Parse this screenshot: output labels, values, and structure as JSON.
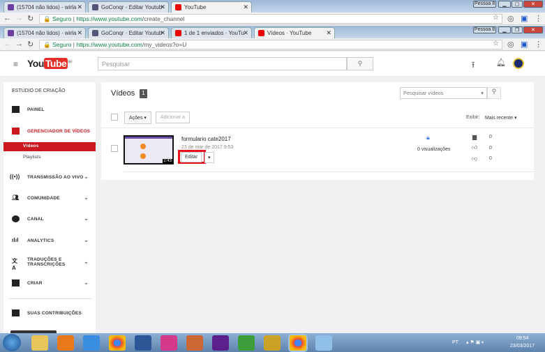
{
  "window1": {
    "tabs": [
      {
        "label": "(15704 não lidos) - wirla"
      },
      {
        "label": "GoConqr - Editar Youtub"
      },
      {
        "label": "YouTube"
      }
    ],
    "profile": "Pessoa 8",
    "url_secure": "Seguro",
    "url_host": "https://www.youtube.com",
    "url_path": "/create_channel"
  },
  "window2": {
    "tabs": [
      {
        "label": "(15704 não lidos) · wirla"
      },
      {
        "label": "GoConqr · Editar Youtub"
      },
      {
        "label": "1 de 1 enviados · YouTu"
      },
      {
        "label": "Vídeos · YouTube"
      }
    ],
    "profile": "Pessoa 8",
    "url_secure": "Seguro",
    "url_host": "https://www.youtube.com",
    "url_path": "/my_videos?o=U"
  },
  "header": {
    "logo_you": "You",
    "logo_tube": "Tube",
    "region": "BR",
    "search_placeholder": "Pesquisar"
  },
  "sidebar": {
    "title": "ESTÚDIO DE CRIAÇÃO",
    "items": [
      {
        "label": "PAINEL"
      },
      {
        "label": "GERENCIADOR DE VÍDEOS"
      },
      {
        "label": "Vídeos"
      },
      {
        "label": "Playlists"
      },
      {
        "label": "TRANSMISSÃO AO VIVO"
      },
      {
        "label": "COMUNIDADE"
      },
      {
        "label": "CANAL"
      },
      {
        "label": "ANALYTICS"
      },
      {
        "label": "TRADUÇÕES E TRANSCRIÇÕES"
      },
      {
        "label": "CRIAR"
      },
      {
        "label": "SUAS CONTRIBUIÇÕES"
      }
    ]
  },
  "main": {
    "title": "Vídeos",
    "count": "1",
    "search_placeholder": "Pesquisar vídeos",
    "actions_label": "Ações",
    "add_to_label": "Adicionar a",
    "show_label": "Exibir:",
    "sort_label": "Mais recente",
    "videos": [
      {
        "title": "formulario cate2017",
        "date": "23 de mar de 2017 9:53",
        "duration": "2:43",
        "edit_label": "Editar",
        "views": "0 visualizações",
        "comments": "0",
        "likes": "0",
        "dislikes": "0"
      }
    ]
  },
  "taskbar": {
    "lang": "PT",
    "time": "09:54",
    "date": "23/03/2017"
  }
}
